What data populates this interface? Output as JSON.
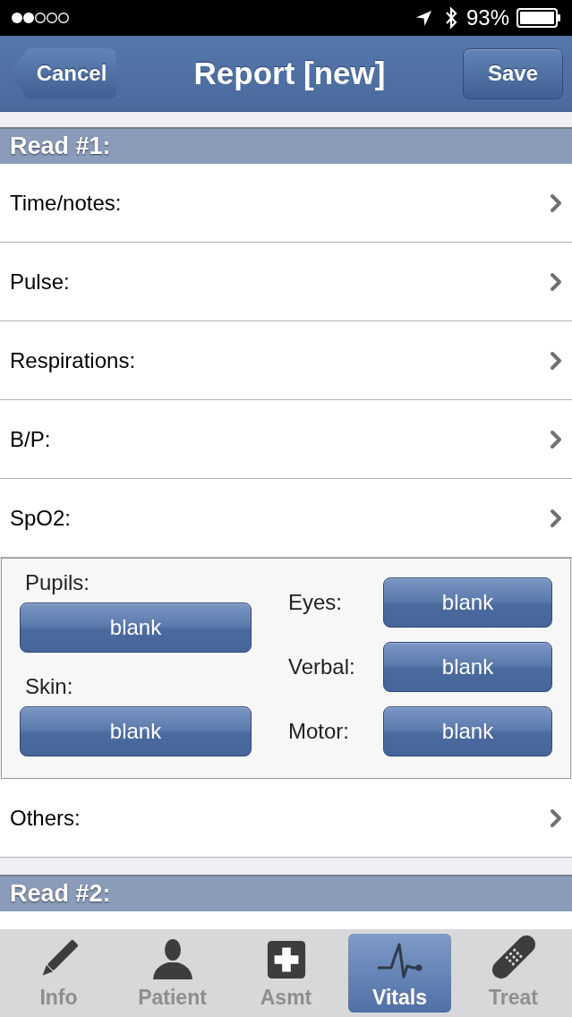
{
  "status_bar": {
    "battery": "93%"
  },
  "nav_bar": {
    "left_button": "Cancel",
    "title": "Report [new]",
    "right_button": "Save"
  },
  "sections": [
    {
      "title": "Read #1:",
      "items": [
        {
          "kind": "row",
          "label": "Time/notes:"
        },
        {
          "kind": "row",
          "label": "Pulse:"
        },
        {
          "kind": "row",
          "label": "Respirations:"
        },
        {
          "kind": "row",
          "label": "B/P:"
        },
        {
          "kind": "row",
          "label": "SpO2:"
        },
        {
          "kind": "panel",
          "left": [
            {
              "label": "Pupils:",
              "value": "blank"
            },
            {
              "label": "Skin:",
              "value": "blank"
            }
          ],
          "right": [
            {
              "label": "Eyes:",
              "value": "blank"
            },
            {
              "label": "Verbal:",
              "value": "blank"
            },
            {
              "label": "Motor:",
              "value": "blank"
            }
          ]
        },
        {
          "kind": "row",
          "label": "Others:"
        }
      ]
    },
    {
      "title": "Read #2:",
      "items": [
        {
          "kind": "partial_row"
        }
      ]
    }
  ],
  "tab_bar": {
    "tabs": [
      {
        "label": "Info",
        "selected": false
      },
      {
        "label": "Patient",
        "selected": false
      },
      {
        "label": "Asmt",
        "selected": false
      },
      {
        "label": "Vitals",
        "selected": true
      },
      {
        "label": "Treat",
        "selected": false
      }
    ]
  }
}
